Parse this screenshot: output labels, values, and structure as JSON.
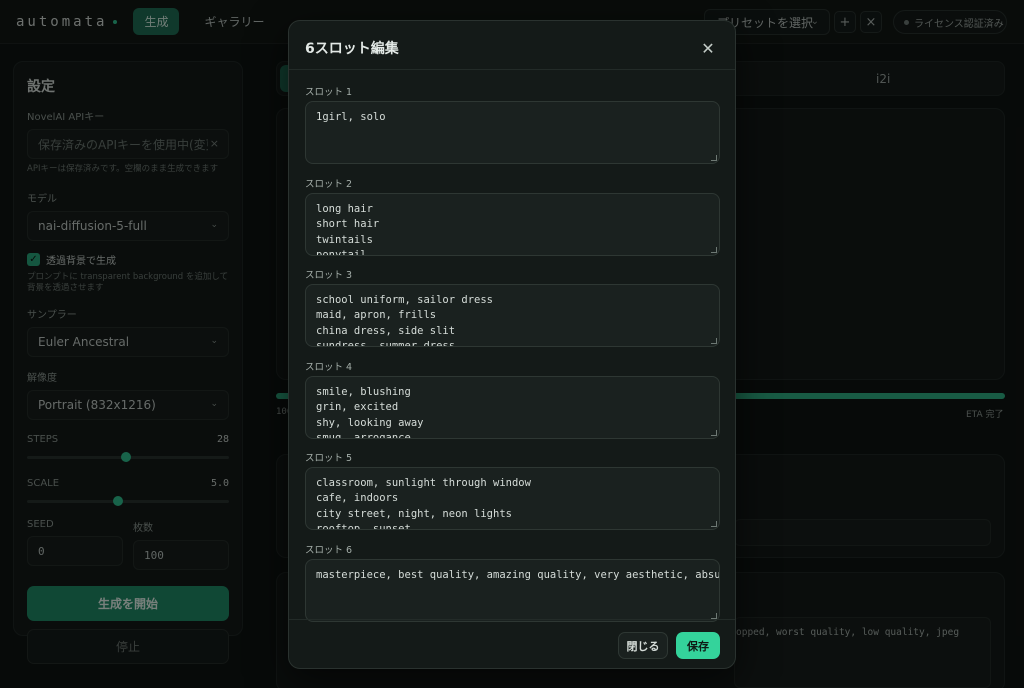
{
  "header": {
    "logo": "automata",
    "tabs": [
      {
        "label": "生成",
        "active": true
      },
      {
        "label": "ギャラリー",
        "active": false
      }
    ],
    "preset_placeholder": "プリセットを選択",
    "add_icon": "+",
    "remove_icon": "×",
    "license_status": "ライセンス認証済み"
  },
  "sidebar": {
    "title": "設定",
    "api_key_label": "NovelAI APIキー",
    "api_key_placeholder": "保存済みのAPIキーを使用中(変更",
    "api_key_note": "APIキーは保存済みです。空欄のまま生成できます",
    "model_label": "モデル",
    "model_value": "nai-diffusion-5-full",
    "transparent_label": "透過背景で生成",
    "transparent_checked": true,
    "transparent_note": "プロンプトに transparent background を追加して背景を透過させます",
    "sampler_label": "サンプラー",
    "sampler_value": "Euler Ancestral",
    "resolution_label": "解像度",
    "resolution_value": "Portrait (832x1216)",
    "steps_label": "STEPS",
    "steps_value": "28",
    "steps_fraction": 0.49,
    "scale_label": "SCALE",
    "scale_value": "5.0",
    "scale_fraction": 0.45,
    "seed_label": "SEED",
    "seed_value": "0",
    "count_label": "枚数",
    "count_value": "100",
    "start_button": "生成を開始",
    "stop_button": "停止"
  },
  "main": {
    "tab_i2i": "i2i",
    "progress_left": "100",
    "progress_right": "ETA 完了",
    "progress_fraction": 1.0,
    "negative_prompt_preview": "opped, worst quality, low quality, jpeg"
  },
  "modal": {
    "title": "6スロット編集",
    "slots": [
      {
        "label": "スロット 1",
        "value": "1girl, solo"
      },
      {
        "label": "スロット 2",
        "value": "long hair\nshort hair\ntwintails\nponytail"
      },
      {
        "label": "スロット 3",
        "value": "school uniform, sailor dress\nmaid, apron, frills\nchina dress, side slit\nsundress, summer dress"
      },
      {
        "label": "スロット 4",
        "value": "smile, blushing\ngrin, excited\nshy, looking away\nsmug, arrogance"
      },
      {
        "label": "スロット 5",
        "value": "classroom, sunlight through window\ncafe, indoors\ncity street, night, neon lights\nrooftop, sunset"
      },
      {
        "label": "スロット 6",
        "value": "masterpiece, best quality, amazing quality, very aesthetic, absurdres"
      }
    ],
    "close_button": "閉じる",
    "save_button": "保存"
  },
  "colors": {
    "accent": "#34d39b",
    "accent_dark": "#1f6e55",
    "background": "#0f1412"
  }
}
